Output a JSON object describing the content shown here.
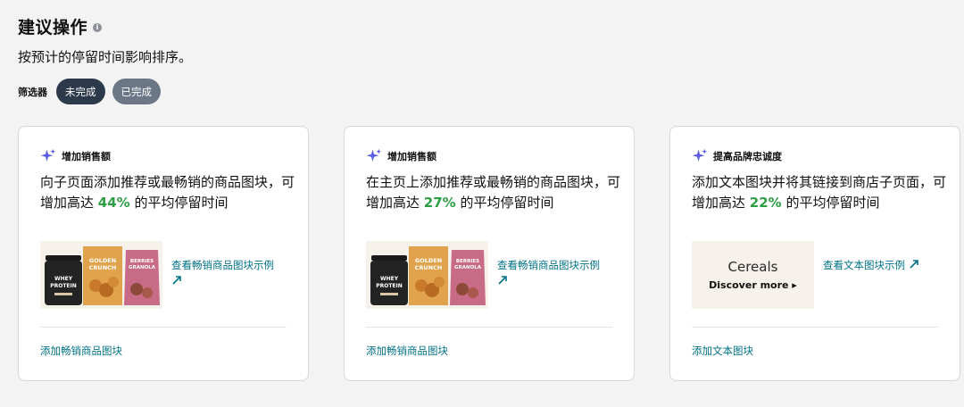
{
  "header": {
    "title": "建议操作",
    "info_icon": "i",
    "subtitle": "按预计的停留时间影响排序。",
    "filter_label": "筛选器",
    "filters": [
      {
        "label": "未完成",
        "active": true
      },
      {
        "label": "已完成",
        "active": false
      }
    ]
  },
  "colors": {
    "accent_green": "#2e9e44",
    "link": "#007185",
    "sparkle": "#5b5ce2",
    "pill_active": "#2d3a4b",
    "pill_inactive": "#6b7787"
  },
  "cards": [
    {
      "tag": "增加销售额",
      "desc_pre": "向子页面添加推荐或最畅销的商品图块，可增加高达 ",
      "pct": "44%",
      "desc_post": " 的平均停留时间",
      "example_link": "查看畅销商品图块示例",
      "action": "添加畅销商品图块",
      "products": [
        "WHEY PROTEIN",
        "GOLDEN CRUNCH",
        "BERRIES GRANOLA"
      ]
    },
    {
      "tag": "增加销售额",
      "desc_pre": "在主页上添加推荐或最畅销的商品图块，可增加高达 ",
      "pct": "27%",
      "desc_post": " 的平均停留时间",
      "example_link": "查看畅销商品图块示例",
      "action": "添加畅销商品图块",
      "products": [
        "WHEY PROTEIN",
        "GOLDEN CRUNCH",
        "BERRIES GRANOLA"
      ]
    },
    {
      "tag": "提高品牌忠诚度",
      "desc_pre": "添加文本图块并将其链接到商店子页面，可增加高达 ",
      "pct": "22%",
      "desc_post": " 的平均停留时间",
      "example_link": "查看文本图块示例",
      "action": "添加文本图块",
      "text_tile": {
        "title": "Cereals",
        "cta": "Discover more ▸"
      }
    }
  ]
}
